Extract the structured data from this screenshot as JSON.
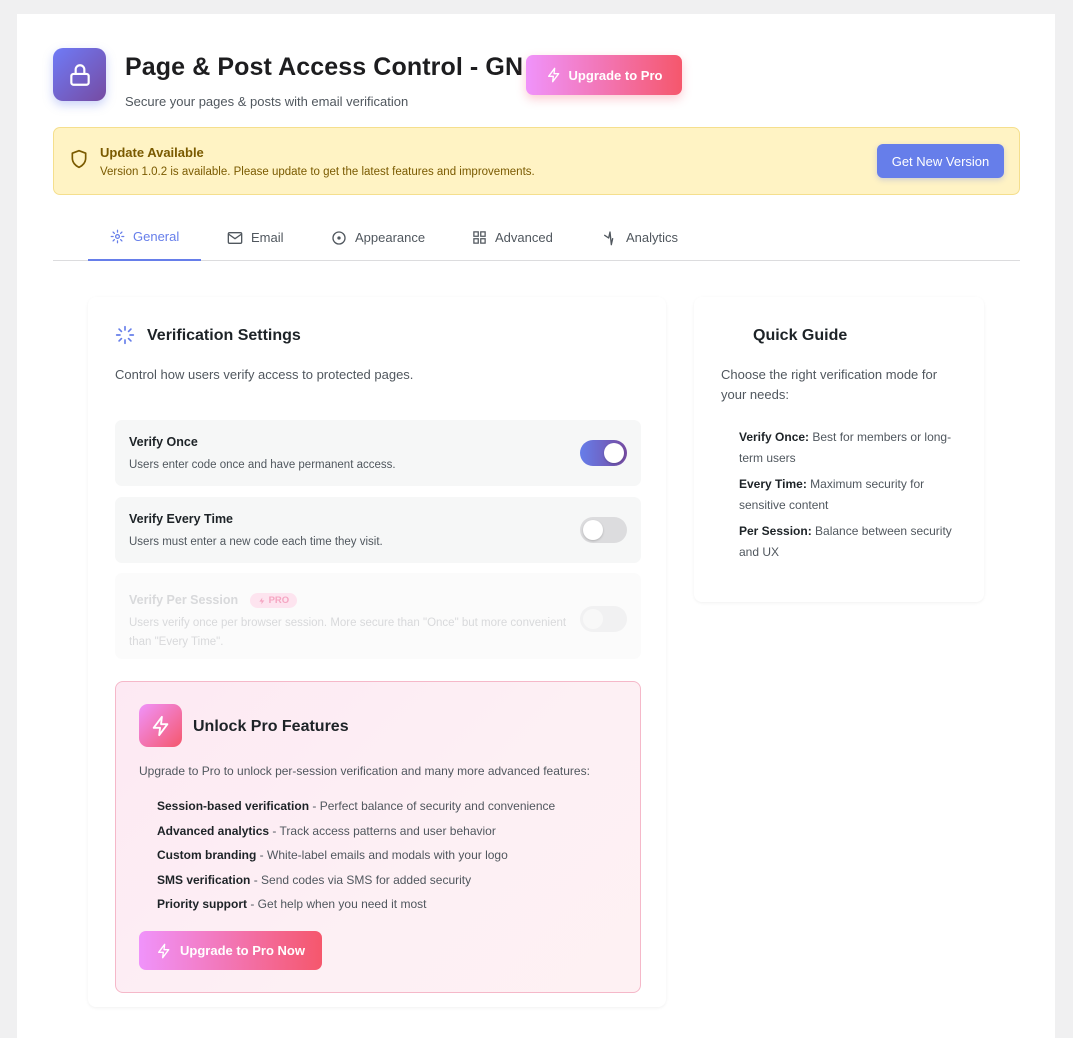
{
  "header": {
    "title": "Page & Post Access Control - GN",
    "subtitle": "Secure your pages & posts with email verification",
    "upgrade_label": "Upgrade to Pro",
    "logo_icon": "lock-icon"
  },
  "notice": {
    "title": "Update Available",
    "text": "Version 1.0.2 is available. Please update to get the latest features and improvements.",
    "button_label": "Get New Version",
    "icon": "shield-icon"
  },
  "tabs": [
    {
      "label": "General",
      "icon": "gear-icon",
      "active": true
    },
    {
      "label": "Email",
      "icon": "mail-icon",
      "active": false
    },
    {
      "label": "Appearance",
      "icon": "circle-icon",
      "active": false
    },
    {
      "label": "Advanced",
      "icon": "grid-icon",
      "active": false
    },
    {
      "label": "Analytics",
      "icon": "activity-icon",
      "active": false
    }
  ],
  "verification": {
    "title": "Verification Settings",
    "description": "Control how users verify access to protected pages.",
    "options": [
      {
        "title": "Verify Once",
        "description": "Users enter code once and have permanent access.",
        "enabled": true
      },
      {
        "title": "Verify Every Time",
        "description": "Users must enter a new code each time they visit.",
        "enabled": false
      },
      {
        "title": "Verify Per Session",
        "badge": "PRO",
        "description": "Users verify once per browser session. More secure than \"Once\" but more convenient than \"Every Time\".",
        "enabled": false
      }
    ]
  },
  "pro": {
    "title": "Unlock Pro Features",
    "description": "Upgrade to Pro to unlock per-session verification and many more advanced features:",
    "features": [
      {
        "name": "Session-based verification",
        "text": " - Perfect balance of security and convenience"
      },
      {
        "name": "Advanced analytics",
        "text": " - Track access patterns and user behavior"
      },
      {
        "name": "Custom branding",
        "text": " - White-label emails and modals with your logo"
      },
      {
        "name": "SMS verification",
        "text": " - Send codes via SMS for added security"
      },
      {
        "name": "Priority support",
        "text": " - Get help when you need it most"
      }
    ],
    "button_label": "Upgrade to Pro Now"
  },
  "guide": {
    "title": "Quick Guide",
    "description": "Choose the right verification mode for your needs:",
    "items": [
      {
        "name": "Verify Once:",
        "text": " Best for members or long-term users"
      },
      {
        "name": "Every Time:",
        "text": " Maximum security for sensitive content"
      },
      {
        "name": "Per Session:",
        "text": " Balance between security and UX"
      }
    ]
  },
  "colors": {
    "accent": "#667eea",
    "pro_gradient_start": "#f093fb",
    "pro_gradient_end": "#f5576c",
    "notice_bg": "#fff3c4"
  }
}
